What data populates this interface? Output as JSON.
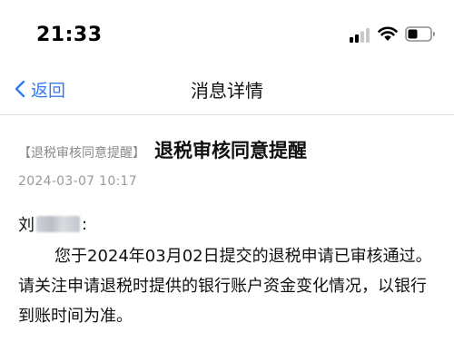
{
  "status_bar": {
    "time": "21:33",
    "icons": [
      "signal-icon",
      "wifi-icon",
      "battery-icon"
    ]
  },
  "nav": {
    "back_label": "返回",
    "title": "消息详情"
  },
  "message": {
    "tag": "【退税审核同意提醒】",
    "title": "退税审核同意提醒",
    "time": "2024-03-07 10:17",
    "greeting_prefix": "刘",
    "greeting_suffix": ":",
    "body": "您于2024年03月02日提交的退税申请已审核通过。请关注申请退税时提供的银行账户资金变化情况，以银行到账时间为准。"
  },
  "colors": {
    "accent": "#2f7bf5",
    "tag_gray": "#8a8a8a",
    "divider": "#dedede"
  }
}
